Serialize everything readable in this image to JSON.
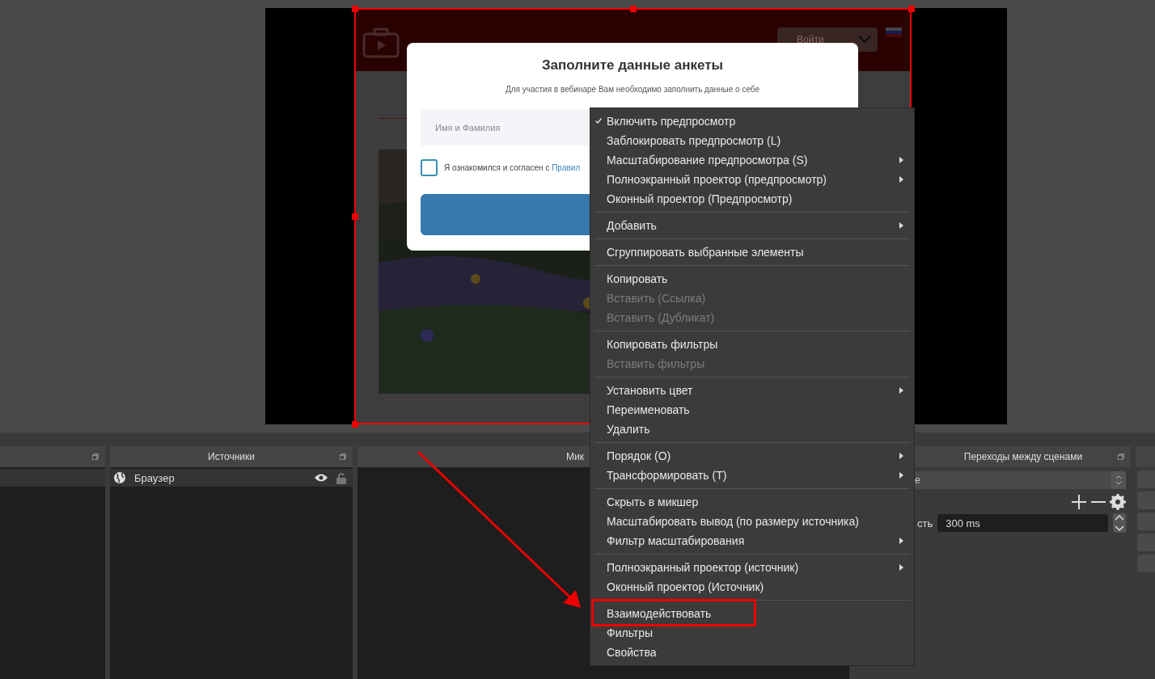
{
  "preview": {
    "page": {
      "login_select": "Войти",
      "modal": {
        "title": "Заполните данные анкеты",
        "subtitle": "Для участия в вебинаре Вам необходимо заполнить данные о себе",
        "name_field": {
          "placeholder": "Имя и Фамилия"
        },
        "consent": {
          "checked": false,
          "text": "Я ознакомился и согласен с ",
          "link": "Правил"
        }
      }
    }
  },
  "context_menu": {
    "groups": [
      [
        {
          "label": "Включить предпросмотр",
          "checked": true,
          "disabled": false,
          "submenu": false,
          "callout": false
        },
        {
          "label": "Заблокировать предпросмотр (L)",
          "checked": false,
          "disabled": false,
          "submenu": false,
          "callout": false
        },
        {
          "label": "Масштабирование предпросмотра (S)",
          "checked": false,
          "disabled": false,
          "submenu": true,
          "callout": false
        },
        {
          "label": "Полноэкранный проектор (предпросмотр)",
          "checked": false,
          "disabled": false,
          "submenu": true,
          "callout": false
        },
        {
          "label": "Оконный проектор (Предпросмотр)",
          "checked": false,
          "disabled": false,
          "submenu": false,
          "callout": false
        }
      ],
      [
        {
          "label": "Добавить",
          "checked": false,
          "disabled": false,
          "submenu": true,
          "callout": false
        }
      ],
      [
        {
          "label": "Сгруппировать выбранные элементы",
          "checked": false,
          "disabled": false,
          "submenu": false,
          "callout": false
        }
      ],
      [
        {
          "label": "Копировать",
          "checked": false,
          "disabled": false,
          "submenu": false,
          "callout": false
        },
        {
          "label": "Вставить (Ссылка)",
          "checked": false,
          "disabled": true,
          "submenu": false,
          "callout": false
        },
        {
          "label": "Вставить (Дубликат)",
          "checked": false,
          "disabled": true,
          "submenu": false,
          "callout": false
        }
      ],
      [
        {
          "label": "Копировать фильтры",
          "checked": false,
          "disabled": false,
          "submenu": false,
          "callout": false
        },
        {
          "label": "Вставить фильтры",
          "checked": false,
          "disabled": true,
          "submenu": false,
          "callout": false
        }
      ],
      [
        {
          "label": "Установить цвет",
          "checked": false,
          "disabled": false,
          "submenu": true,
          "callout": false
        },
        {
          "label": "Переименовать",
          "checked": false,
          "disabled": false,
          "submenu": false,
          "callout": false
        },
        {
          "label": "Удалить",
          "checked": false,
          "disabled": false,
          "submenu": false,
          "callout": false
        }
      ],
      [
        {
          "label": "Порядок (O)",
          "checked": false,
          "disabled": false,
          "submenu": true,
          "callout": false
        },
        {
          "label": "Трансформировать (T)",
          "checked": false,
          "disabled": false,
          "submenu": true,
          "callout": false
        }
      ],
      [
        {
          "label": "Скрыть в микшер",
          "checked": false,
          "disabled": false,
          "submenu": false,
          "callout": false
        },
        {
          "label": "Масштабировать вывод (по размеру источника)",
          "checked": false,
          "disabled": false,
          "submenu": false,
          "callout": false
        },
        {
          "label": "Фильтр масштабирования",
          "checked": false,
          "disabled": false,
          "submenu": true,
          "callout": false
        }
      ],
      [
        {
          "label": "Полноэкранный проектор (источник)",
          "checked": false,
          "disabled": false,
          "submenu": true,
          "callout": false
        },
        {
          "label": "Оконный проектор (Источник)",
          "checked": false,
          "disabled": false,
          "submenu": false,
          "callout": false
        }
      ],
      [
        {
          "label": "Взаимодействовать",
          "checked": false,
          "disabled": false,
          "submenu": false,
          "callout": true
        },
        {
          "label": "Фильтры",
          "checked": false,
          "disabled": false,
          "submenu": false,
          "callout": false
        },
        {
          "label": "Свойства",
          "checked": false,
          "disabled": false,
          "submenu": false,
          "callout": false
        }
      ]
    ]
  },
  "sources": {
    "title": "Источники",
    "items": [
      {
        "name": "Браузер",
        "visible": true,
        "locked": false
      }
    ]
  },
  "mixer": {
    "title": "Мик"
  },
  "transitions": {
    "title": "Переходы между сценами",
    "select_value": "e",
    "duration_label": "сть",
    "duration": "300 ms"
  }
}
